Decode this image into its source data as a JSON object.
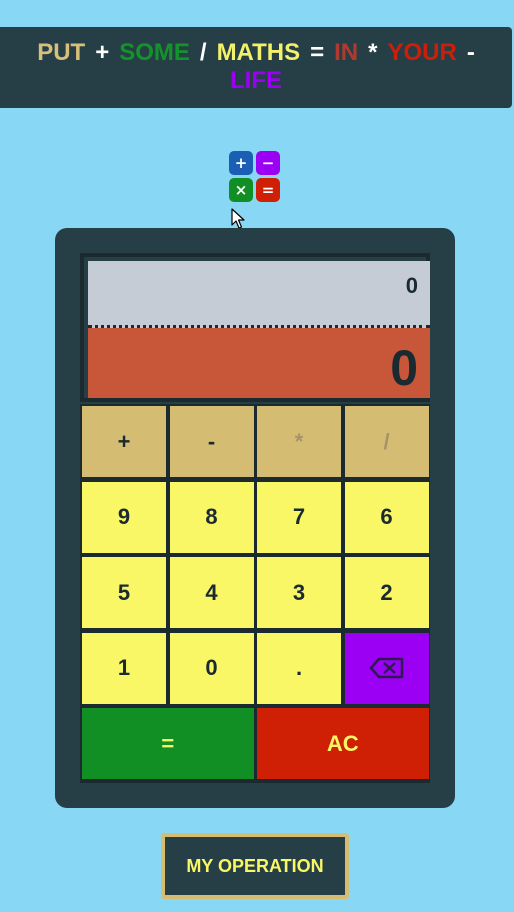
{
  "banner": [
    {
      "text": "PUT",
      "color": "#d8c07a"
    },
    {
      "text": "+",
      "color": "#ffffff"
    },
    {
      "text": "SOME",
      "color": "#14932a"
    },
    {
      "text": "/",
      "color": "#ffffff"
    },
    {
      "text": "MATHS",
      "color": "#f3f06a"
    },
    {
      "text": "=",
      "color": "#ffffff"
    },
    {
      "text": "IN",
      "color": "#b03a2e"
    },
    {
      "text": "*",
      "color": "#ffffff"
    },
    {
      "text": "YOUR",
      "color": "#cc1f0a"
    },
    {
      "text": "-",
      "color": "#ffffff"
    },
    {
      "text": "LIFE",
      "color": "#9b00f5"
    }
  ],
  "logo": {
    "tiles": [
      {
        "icon": "plus-icon",
        "glyph": "+",
        "color": "#1a5fb4"
      },
      {
        "icon": "minus-icon",
        "glyph": "−",
        "color": "#9b00f5"
      },
      {
        "icon": "times-icon",
        "glyph": "×",
        "color": "#118e24"
      },
      {
        "icon": "equals-icon",
        "glyph": "=",
        "color": "#cf1f05"
      }
    ]
  },
  "display": {
    "previous": "0",
    "current": "0"
  },
  "keys": {
    "plus": "+",
    "minus": "-",
    "multiply": "*",
    "divide": "/",
    "n9": "9",
    "n8": "8",
    "n7": "7",
    "n6": "6",
    "n5": "5",
    "n4": "4",
    "n3": "3",
    "n2": "2",
    "n1": "1",
    "n0": "0",
    "dot": ".",
    "backspace_icon": "backspace-icon",
    "equals": "=",
    "clear": "AC"
  },
  "footer": {
    "my_operation": "MY OPERATION"
  },
  "colors": {
    "background": "#88d7f5",
    "panel": "#263f47",
    "operator_key": "#d4bd72",
    "number_key": "#f9f766",
    "backspace_key": "#9b00f5",
    "equals_key": "#118e24",
    "clear_key": "#cf1f05",
    "current_display": "#c8573a",
    "previous_display": "#c6ccd5"
  }
}
